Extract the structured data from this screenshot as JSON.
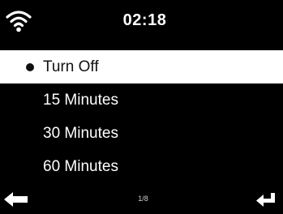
{
  "status_bar": {
    "wifi_icon": "wifi-icon",
    "time": "02:18"
  },
  "menu": {
    "items": [
      {
        "label": "Turn Off",
        "selected": true
      },
      {
        "label": "15 Minutes",
        "selected": false
      },
      {
        "label": "30 Minutes",
        "selected": false
      },
      {
        "label": "60 Minutes",
        "selected": false
      }
    ]
  },
  "footer": {
    "back_icon": "back-arrow-icon",
    "page_indicator": "1/8",
    "enter_icon": "enter-icon"
  },
  "colors": {
    "background": "#000000",
    "text": "#ffffff",
    "selection_background": "#ffffff",
    "selection_text": "#111111"
  }
}
